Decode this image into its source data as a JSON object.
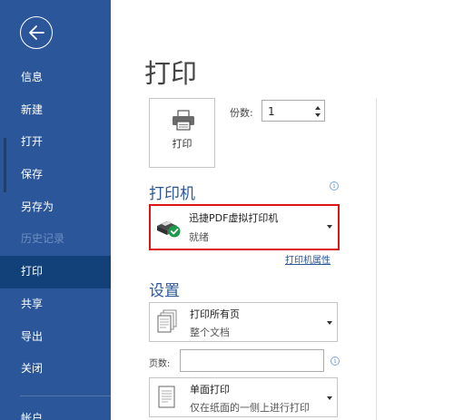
{
  "sidebar": {
    "back_icon": "arrow-left-circle-icon",
    "items": [
      {
        "label": "信息",
        "state": "normal"
      },
      {
        "label": "新建",
        "state": "normal"
      },
      {
        "label": "打开",
        "state": "normal"
      },
      {
        "label": "保存",
        "state": "normal"
      },
      {
        "label": "另存为",
        "state": "normal"
      },
      {
        "label": "历史记录",
        "state": "disabled"
      },
      {
        "label": "打印",
        "state": "active"
      },
      {
        "label": "共享",
        "state": "normal"
      },
      {
        "label": "导出",
        "state": "normal"
      },
      {
        "label": "关闭",
        "state": "normal"
      }
    ],
    "account_label": "帐户"
  },
  "main": {
    "title": "打印",
    "print_button": {
      "label": "打印",
      "icon": "printer-icon"
    },
    "copies": {
      "label": "份数:",
      "value": "1"
    },
    "printer_section": {
      "title": "打印机",
      "info_icon": "info-icon",
      "selected": {
        "name": "迅捷PDF虚拟打印机",
        "status": "就绪",
        "icon": "printer-ready-icon"
      },
      "properties_link": "打印机属性"
    },
    "settings_section": {
      "title": "设置",
      "print_range": {
        "line1": "打印所有页",
        "line2": "整个文档",
        "icon": "pages-icon"
      },
      "pages": {
        "label": "页数:",
        "value": "",
        "placeholder": ""
      },
      "sides": {
        "line1": "单面打印",
        "line2": "仅在纸面的一侧上进行打印",
        "icon": "single-sided-icon"
      }
    }
  },
  "colors": {
    "sidebar_bg": "#2b579a",
    "sidebar_active": "#124078",
    "accent": "#2b579a",
    "highlight_border": "#d9141a",
    "ready_badge": "#1a9b4a"
  }
}
